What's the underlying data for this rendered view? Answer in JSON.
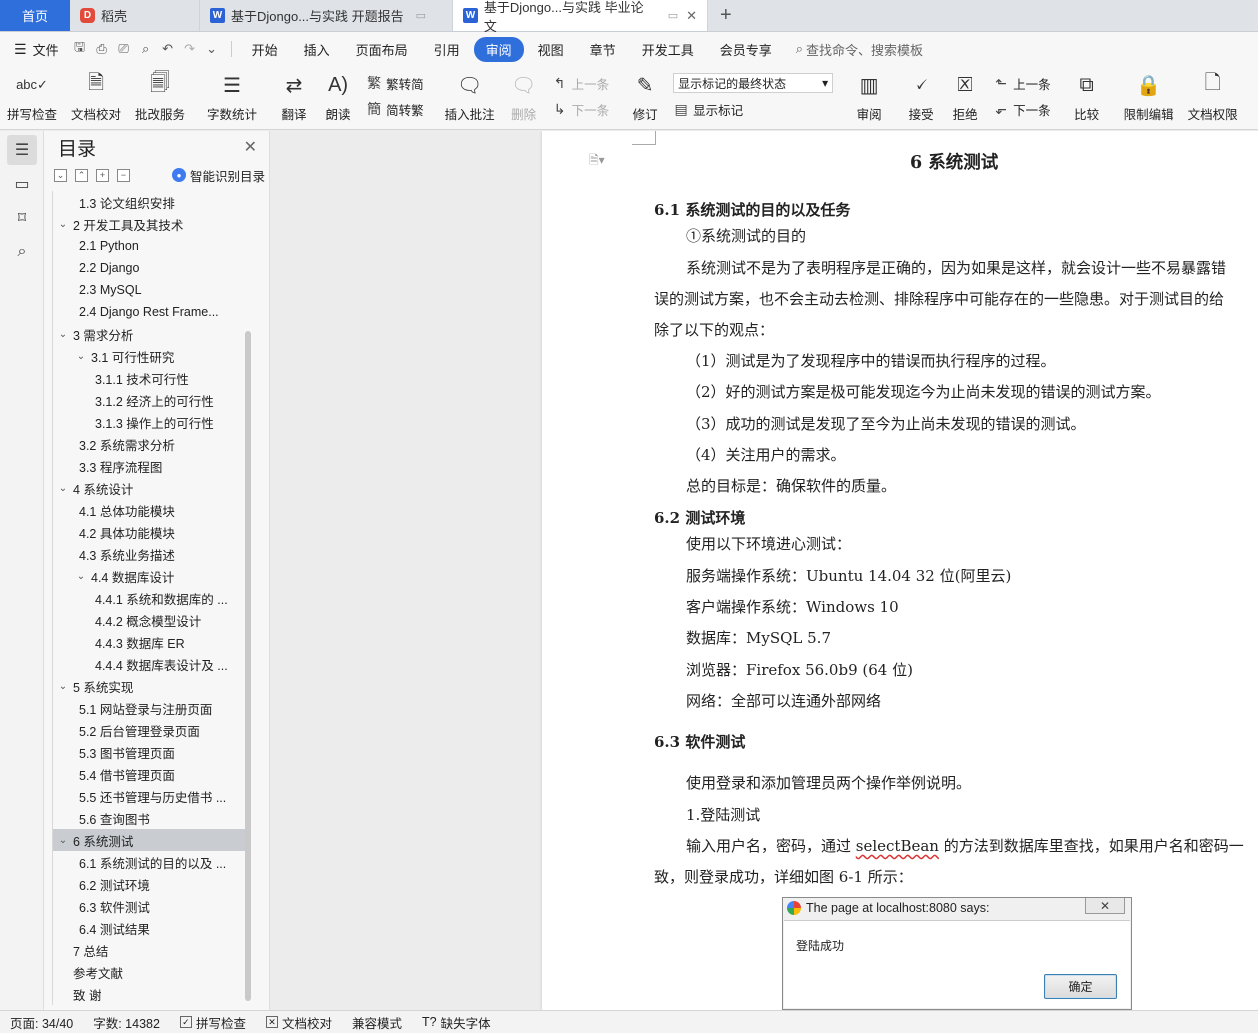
{
  "tabs": [
    {
      "label": "首页",
      "kind": "home"
    },
    {
      "label": "稻壳",
      "kind": "docer"
    },
    {
      "label": "基于Djongo...与实践 开题报告",
      "kind": "doc"
    },
    {
      "label": "基于Djongo...与实践 毕业论文",
      "kind": "doc",
      "active": true
    }
  ],
  "menubar": {
    "file_label": "文件",
    "items": [
      "开始",
      "插入",
      "页面布局",
      "引用",
      "审阅",
      "视图",
      "章节",
      "开发工具",
      "会员专享"
    ],
    "selected": "审阅",
    "search_placeholder": "查找命令、搜索模板"
  },
  "ribbon": {
    "spellcheck": "拼写检查",
    "doc_proof": "文档校对",
    "review_service": "批改服务",
    "word_count": "字数统计",
    "translate": "翻译",
    "read_aloud": "朗读",
    "trad": "繁转简",
    "simp": "简转繁",
    "insert_comment": "插入批注",
    "delete": "删除",
    "prev": "上一条",
    "next": "下一条",
    "track_changes": "修订",
    "markup_state": "显示标记的最终状态",
    "show_markup": "显示标记",
    "review": "审阅",
    "accept": "接受",
    "reject": "拒绝",
    "prev2": "上一条",
    "next2": "下一条",
    "compare": "比较",
    "restrict_edit": "限制编辑",
    "doc_permission": "文档权限",
    "cut_off": "文"
  },
  "toc": {
    "title": "目录",
    "smart_label": "智能识别目录",
    "items": [
      {
        "text": "1.3  论文组织安排",
        "level": 2
      },
      {
        "text": "2  开发工具及其技术",
        "level": 1,
        "expanded": true
      },
      {
        "text": "2.1 Python",
        "level": 2
      },
      {
        "text": "2.2 Django",
        "level": 2
      },
      {
        "text": "2.3 MySQL",
        "level": 2
      },
      {
        "text": "2.4 Django Rest Frame...",
        "level": 2
      },
      {
        "text": "3  需求分析",
        "level": 1,
        "expanded": true
      },
      {
        "text": "3.1  可行性研究",
        "level": 2,
        "expanded": true
      },
      {
        "text": "3.1.1  技术可行性",
        "level": 3
      },
      {
        "text": "3.1.2  经济上的可行性",
        "level": 3
      },
      {
        "text": "3.1.3  操作上的可行性",
        "level": 3
      },
      {
        "text": "3.2  系统需求分析",
        "level": 2
      },
      {
        "text": "3.3  程序流程图",
        "level": 2
      },
      {
        "text": "4  系统设计",
        "level": 1,
        "expanded": true
      },
      {
        "text": "4.1  总体功能模块",
        "level": 2
      },
      {
        "text": "4.2  具体功能模块",
        "level": 2
      },
      {
        "text": "4.3  系统业务描述",
        "level": 2
      },
      {
        "text": "4.4  数据库设计",
        "level": 2,
        "expanded": true
      },
      {
        "text": "4.4.1  系统和数据库的 ...",
        "level": 3
      },
      {
        "text": "4.4.2  概念模型设计",
        "level": 3
      },
      {
        "text": "4.4.3  数据库 ER",
        "level": 3
      },
      {
        "text": "4.4.4  数据库表设计及 ...",
        "level": 3
      },
      {
        "text": "5  系统实现",
        "level": 1,
        "expanded": true
      },
      {
        "text": "5.1  网站登录与注册页面",
        "level": 2
      },
      {
        "text": "5.2  后台管理登录页面",
        "level": 2
      },
      {
        "text": "5.3  图书管理页面",
        "level": 2
      },
      {
        "text": "5.4  借书管理页面",
        "level": 2
      },
      {
        "text": "5.5  还书管理与历史借书 ...",
        "level": 2
      },
      {
        "text": "5.6  查询图书",
        "level": 2
      },
      {
        "text": "6  系统测试",
        "level": 1,
        "expanded": true,
        "selected": true
      },
      {
        "text": "6.1  系统测试的目的以及 ...",
        "level": 2
      },
      {
        "text": "6.2  测试环境",
        "level": 2
      },
      {
        "text": "6.3  软件测试",
        "level": 2
      },
      {
        "text": "6.4  测试结果",
        "level": 2
      },
      {
        "text": "7  总结",
        "level": 1
      },
      {
        "text": "参考文献",
        "level": 1
      },
      {
        "text": "致    谢",
        "level": 1
      }
    ]
  },
  "doc": {
    "chapter": "6  系统测试",
    "s61": "6.1  系统测试的目的以及任务",
    "p_purpose": "①系统测试的目的",
    "p1a": "系统测试不是为了表明程序是正确的，因为如果是这样，就会设计一些不易暴露错",
    "p1b": "误的测试方案，也不会主动去检测、排除程序中可能存在的一些隐患。对于测试目的给",
    "p1c": "除了以下的观点：",
    "l1": "（1）测试是为了发现程序中的错误而执行程序的过程。",
    "l2": "（2）好的测试方案是极可能发现迄今为止尚未发现的错误的测试方案。",
    "l3": "（3）成功的测试是发现了至今为止尚未发现的错误的测试。",
    "l4": "（4）关注用户的需求。",
    "goal": "总的目标是：确保软件的质量。",
    "s62": "6.2  测试环境",
    "env_intro": "使用以下环境进心测试：",
    "env_server": "服务端操作系统：Ubuntu 14.04 32 位(阿里云)",
    "env_client": "客户端操作系统：Windows 10",
    "env_db": "数据库：MySQL 5.7",
    "env_browser": "浏览器：Firefox 56.0b9 (64 位)",
    "env_net": "网络：全部可以连通外部网络",
    "s63": "6.3  软件测试",
    "t_intro": "使用登录和添加管理员两个操作举例说明。",
    "t_login": "1.登陆测试",
    "t_p1a_pre": "输入用户名，密码，通过 ",
    "t_p1a_word": "selectBean",
    "t_p1a_post": " 的方法到数据库里查找，如果用户名和密码一",
    "t_p1b": "致，则登录成功，详细如图 6-1 所示："
  },
  "dialog": {
    "title": "The page at localhost:8080 says:",
    "message": "登陆成功",
    "ok": "确定"
  },
  "status": {
    "page": "页面: 34/40",
    "words": "字数: 14382",
    "spell": "拼写检查",
    "proof": "文档校对",
    "compat": "兼容模式",
    "missing_font": "缺失字体"
  },
  "colors": {
    "accent": "#2f6fdc",
    "tab_bg": "#dfe3e8",
    "toc_selected": "#c9ccd1"
  }
}
